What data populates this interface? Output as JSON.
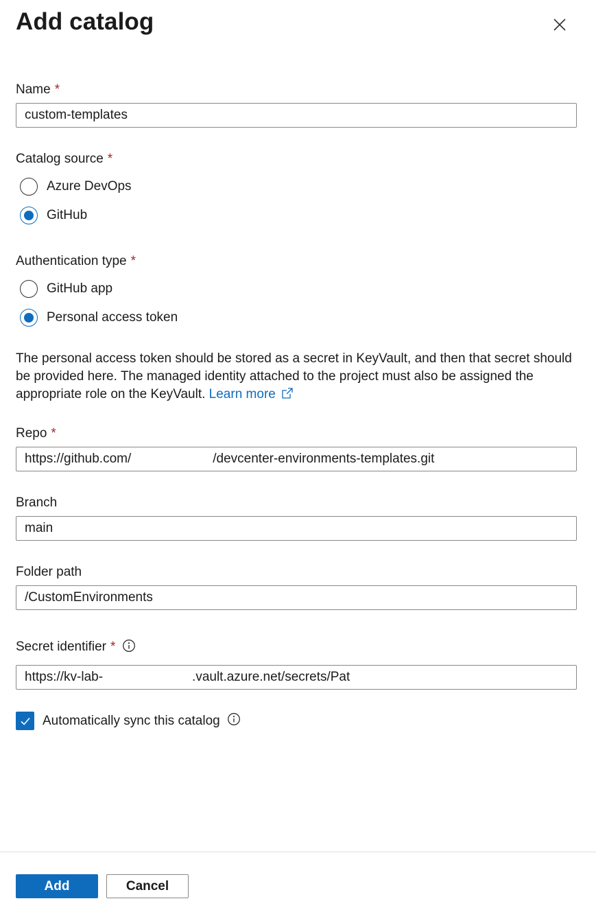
{
  "panel": {
    "title": "Add catalog",
    "close_icon": "close-icon"
  },
  "name": {
    "label": "Name",
    "required": "*",
    "value": "custom-templates"
  },
  "catalog_source": {
    "label": "Catalog source",
    "required": "*",
    "options": [
      {
        "label": "Azure DevOps",
        "selected": false
      },
      {
        "label": "GitHub",
        "selected": true
      }
    ]
  },
  "auth_type": {
    "label": "Authentication type",
    "required": "*",
    "options": [
      {
        "label": "GitHub app",
        "selected": false
      },
      {
        "label": "Personal access token",
        "selected": true
      }
    ]
  },
  "description": {
    "text": "The personal access token should be stored as a secret in KeyVault, and then that secret should be provided here. The managed identity attached to the project must also be assigned the appropriate role on the KeyVault.",
    "link_label": "Learn more",
    "link_icon": "external-link-icon"
  },
  "repo": {
    "label": "Repo",
    "required": "*",
    "value_prefix": "https://github.com/",
    "value_suffix": "/devcenter-environments-templates.git"
  },
  "branch": {
    "label": "Branch",
    "value": "main"
  },
  "folder_path": {
    "label": "Folder path",
    "value": "/CustomEnvironments"
  },
  "secret_identifier": {
    "label": "Secret identifier",
    "required": "*",
    "info_icon": "info-icon",
    "value_prefix": "https://kv-lab-",
    "value_suffix": ".vault.azure.net/secrets/Pat"
  },
  "auto_sync": {
    "label": "Automatically sync this catalog",
    "checked": true,
    "info_icon": "info-icon"
  },
  "footer": {
    "add_label": "Add",
    "cancel_label": "Cancel"
  },
  "colors": {
    "accent": "#0f6cbd",
    "required": "#a4262c",
    "border": "#8a8886",
    "text": "#1b1b1b"
  }
}
